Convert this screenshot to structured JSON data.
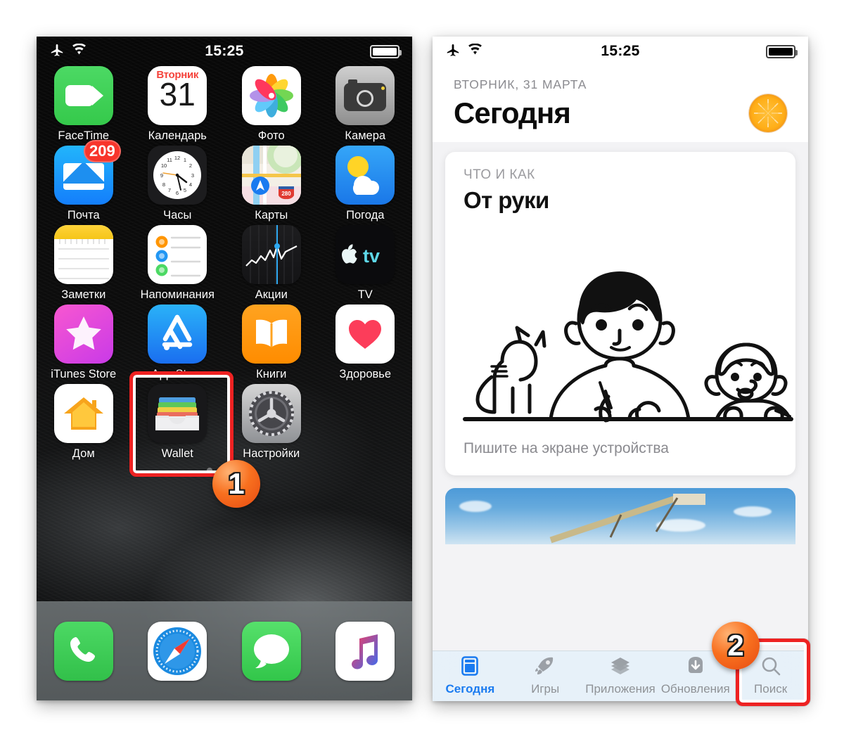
{
  "colors": {
    "accent_red": "#ee2222",
    "step_orange": "#f8701f",
    "tab_active_blue": "#1a7bf0",
    "badge_red": "#f8352c",
    "appstore_blue": "#1a6ef0"
  },
  "home_screen": {
    "status_bar": {
      "airplane_icon": "airplane-mode-icon",
      "wifi_icon": "wifi-icon",
      "time": "15:25",
      "battery_icon": "battery-full-icon"
    },
    "rows": [
      [
        {
          "label": "FaceTime",
          "icon": "facetime-icon"
        },
        {
          "label": "Календарь",
          "icon": "calendar-icon",
          "weekday": "Вторник",
          "day": "31"
        },
        {
          "label": "Фото",
          "icon": "photos-icon"
        },
        {
          "label": "Камера",
          "icon": "camera-icon"
        }
      ],
      [
        {
          "label": "Почта",
          "icon": "mail-icon",
          "badge": "209"
        },
        {
          "label": "Часы",
          "icon": "clock-icon"
        },
        {
          "label": "Карты",
          "icon": "maps-icon",
          "shield": "280"
        },
        {
          "label": "Погода",
          "icon": "weather-icon"
        }
      ],
      [
        {
          "label": "Заметки",
          "icon": "notes-icon"
        },
        {
          "label": "Напоминания",
          "icon": "reminders-icon"
        },
        {
          "label": "Акции",
          "icon": "stocks-icon"
        },
        {
          "label": "TV",
          "icon": "tv-icon"
        }
      ],
      [
        {
          "label": "iTunes Store",
          "icon": "itunes-store-icon"
        },
        {
          "label": "App Store",
          "icon": "app-store-icon"
        },
        {
          "label": "Книги",
          "icon": "books-icon"
        },
        {
          "label": "Здоровье",
          "icon": "health-icon"
        }
      ],
      [
        {
          "label": "Дом",
          "icon": "home-icon"
        },
        {
          "label": "Wallet",
          "icon": "wallet-icon"
        },
        {
          "label": "Настройки",
          "icon": "settings-icon"
        }
      ]
    ],
    "page_dots": {
      "count": 3,
      "active_index": 1
    },
    "dock": [
      {
        "label": "Телефон",
        "icon": "phone-icon"
      },
      {
        "label": "Safari",
        "icon": "safari-icon"
      },
      {
        "label": "Сообщения",
        "icon": "messages-icon"
      },
      {
        "label": "Музыка",
        "icon": "music-icon"
      }
    ]
  },
  "app_store": {
    "status_bar": {
      "airplane_icon": "airplane-mode-icon",
      "wifi_icon": "wifi-icon",
      "time": "15:25",
      "battery_icon": "battery-full-icon"
    },
    "header": {
      "date": "ВТОРНИК, 31 МАРТА",
      "title": "Сегодня",
      "avatar_icon": "orange-slice-avatar"
    },
    "featured_card": {
      "kicker": "ЧТО И КАК",
      "title": "От руки",
      "artwork": "illustration-boy-cat-monkey-drawing",
      "caption": "Пишите на экране устройства"
    },
    "next_card": {
      "artwork": "photo-blue-sky-crane"
    },
    "tabs": [
      {
        "label": "Сегодня",
        "icon": "today-icon",
        "active": true
      },
      {
        "label": "Игры",
        "icon": "rocket-icon",
        "active": false
      },
      {
        "label": "Приложения",
        "icon": "layers-icon",
        "active": false
      },
      {
        "label": "Обновления",
        "icon": "download-icon",
        "active": false
      },
      {
        "label": "Поиск",
        "icon": "search-icon",
        "active": false
      }
    ]
  },
  "annotations": {
    "step1": {
      "number": "1",
      "target": "App Store app icon"
    },
    "step2": {
      "number": "2",
      "target": "Поиск tab"
    }
  }
}
